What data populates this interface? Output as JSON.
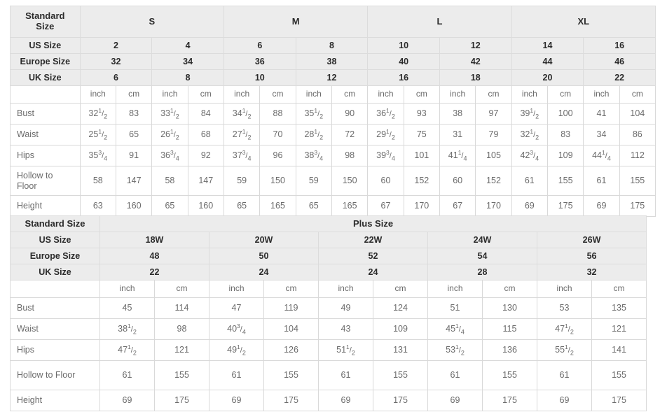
{
  "standard_table": {
    "corner_label": "Standard Size",
    "size_groups": [
      {
        "label": "S",
        "span": 4
      },
      {
        "label": "M",
        "span": 4
      },
      {
        "label": "L",
        "span": 4
      },
      {
        "label": "XL",
        "span": 4
      }
    ],
    "size_rows": [
      {
        "label": "US Size",
        "values": [
          "2",
          "4",
          "6",
          "8",
          "10",
          "12",
          "14",
          "16"
        ]
      },
      {
        "label": "Europe Size",
        "values": [
          "32",
          "34",
          "36",
          "38",
          "40",
          "42",
          "44",
          "46"
        ]
      },
      {
        "label": "UK Size",
        "values": [
          "6",
          "8",
          "10",
          "12",
          "16",
          "18",
          "20",
          "22"
        ]
      }
    ],
    "unit_labels": [
      "inch",
      "cm"
    ],
    "measure_rows": [
      {
        "label": "Bust",
        "inch": [
          "32 1/2",
          "33 1/2",
          "34 1/2",
          "35 1/2",
          "36 1/2",
          "38",
          "39 1/2",
          "41"
        ],
        "cm": [
          "83",
          "84",
          "88",
          "90",
          "93",
          "97",
          "100",
          "104"
        ]
      },
      {
        "label": "Waist",
        "inch": [
          "25 1/2",
          "26 1/2",
          "27 1/2",
          "28 1/2",
          "29 1/2",
          "31",
          "32 1/2",
          "34"
        ],
        "cm": [
          "65",
          "68",
          "70",
          "72",
          "75",
          "79",
          "83",
          "86"
        ]
      },
      {
        "label": "Hips",
        "inch": [
          "35 3/4",
          "36 3/4",
          "37 3/4",
          "38 3/4",
          "39 3/4",
          "41 1/4",
          "42 3/4",
          "44 1/4"
        ],
        "cm": [
          "91",
          "92",
          "96",
          "98",
          "101",
          "105",
          "109",
          "112"
        ]
      },
      {
        "label": "Hollow to Floor",
        "inch": [
          "58",
          "58",
          "59",
          "59",
          "60",
          "60",
          "61",
          "61"
        ],
        "cm": [
          "147",
          "147",
          "150",
          "150",
          "152",
          "152",
          "155",
          "155"
        ]
      },
      {
        "label": "Height",
        "inch": [
          "63",
          "65",
          "65",
          "65",
          "67",
          "67",
          "69",
          "69"
        ],
        "cm": [
          "160",
          "160",
          "165",
          "165",
          "170",
          "170",
          "175",
          "175"
        ]
      }
    ]
  },
  "plus_table": {
    "corner_label": "Standard Size",
    "group_label": "Plus Size",
    "size_rows": [
      {
        "label": "US Size",
        "values": [
          "18W",
          "20W",
          "22W",
          "24W",
          "26W"
        ]
      },
      {
        "label": "Europe Size",
        "values": [
          "48",
          "50",
          "52",
          "54",
          "56"
        ]
      },
      {
        "label": "UK Size",
        "values": [
          "22",
          "24",
          "24",
          "28",
          "32"
        ]
      }
    ],
    "unit_labels": [
      "inch",
      "cm"
    ],
    "measure_rows": [
      {
        "label": "Bust",
        "inch": [
          "45",
          "47",
          "49",
          "51",
          "53"
        ],
        "cm": [
          "114",
          "119",
          "124",
          "130",
          "135"
        ]
      },
      {
        "label": "Waist",
        "inch": [
          "38 1/2",
          "40 3/4",
          "43",
          "45 1/4",
          "47 1/2"
        ],
        "cm": [
          "98",
          "104",
          "109",
          "115",
          "121"
        ]
      },
      {
        "label": "Hips",
        "inch": [
          "47 1/2",
          "49 1/2",
          "51 1/2",
          "53 1/2",
          "55 1/2"
        ],
        "cm": [
          "121",
          "126",
          "131",
          "136",
          "141"
        ]
      },
      {
        "label": "Hollow to Floor",
        "inch": [
          "61",
          "61",
          "61",
          "61",
          "61"
        ],
        "cm": [
          "155",
          "155",
          "155",
          "155",
          "155"
        ]
      },
      {
        "label": "Height",
        "inch": [
          "69",
          "69",
          "69",
          "69",
          "69"
        ],
        "cm": [
          "175",
          "175",
          "175",
          "175",
          "175"
        ]
      }
    ]
  },
  "colors": {
    "header_bg": "#ececec",
    "border": "#d9d9d9",
    "header_text": "#2b2b2b",
    "body_text": "#6b6b6b",
    "page_bg": "#ffffff"
  }
}
